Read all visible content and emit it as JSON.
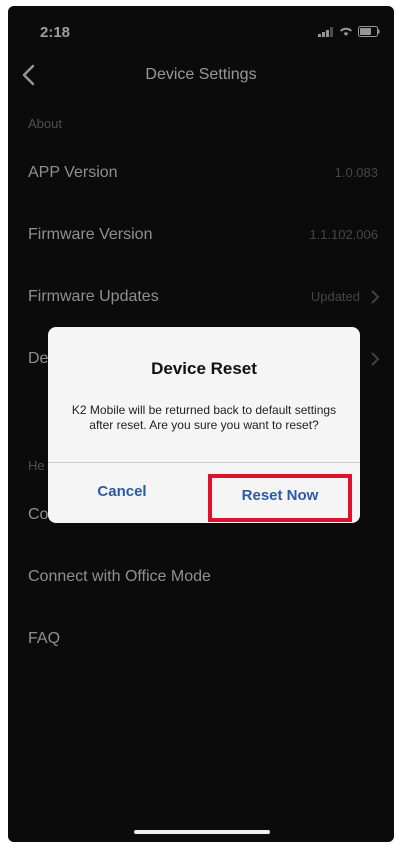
{
  "status_bar": {
    "time": "2:18"
  },
  "nav": {
    "title": "Device Settings"
  },
  "sections": {
    "about_header": "About",
    "help_header_partial": "He"
  },
  "rows": {
    "app_version": {
      "label": "APP Version",
      "value": "1.0.083"
    },
    "firmware_version": {
      "label": "Firmware Version",
      "value": "1.1.102.006"
    },
    "firmware_updates": {
      "label": "Firmware Updates",
      "value": "Updated"
    },
    "device_reset_partial": {
      "label": "De"
    },
    "connect_partial": {
      "label": "Co"
    },
    "connect_office": {
      "label": "Connect with Office Mode"
    },
    "faq": {
      "label": "FAQ"
    }
  },
  "dialog": {
    "title": "Device Reset",
    "message": "K2 Mobile will be returned back to default settings after reset. Are you sure you want to reset?",
    "cancel_label": "Cancel",
    "reset_label": "Reset Now"
  },
  "colors": {
    "background": "#111111",
    "dialog_bg": "#f5f5f5",
    "button_text": "#2b5aa5",
    "highlight": "#e0112b"
  },
  "icons": [
    "signal-icon",
    "wifi-icon",
    "battery-icon",
    "back-chevron-icon",
    "chevron-right-icon"
  ]
}
